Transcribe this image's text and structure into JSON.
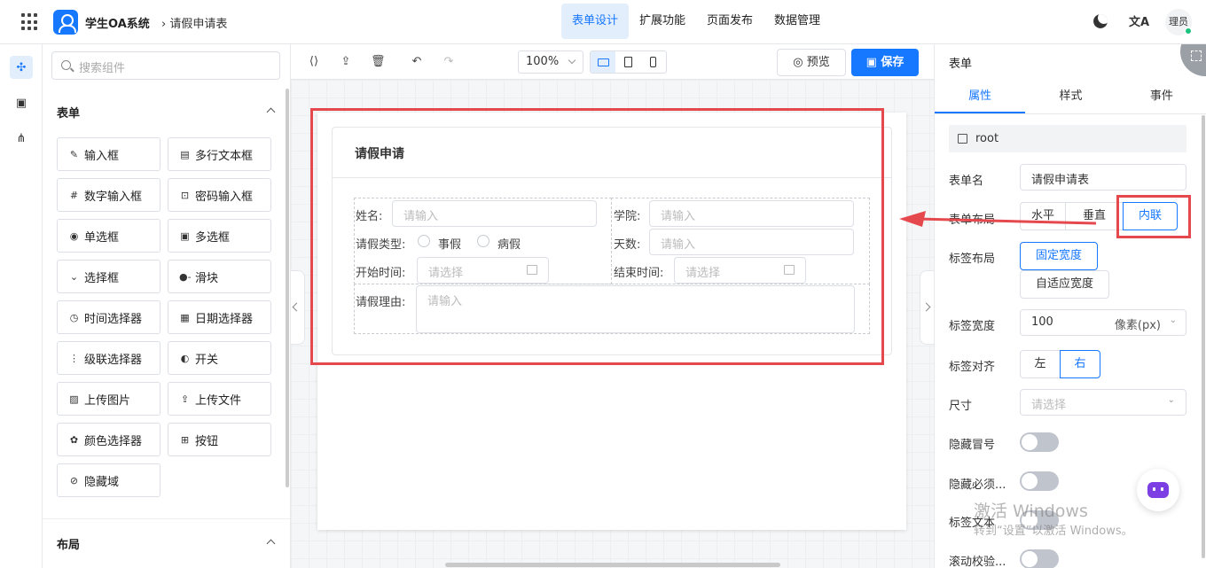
{
  "topbar": {
    "app_name": "学生OA系统",
    "breadcrumb": "请假申请表",
    "nav": [
      "表单设计",
      "扩展功能",
      "页面发布",
      "数据管理"
    ],
    "active_nav": "表单设计",
    "lang_label": "文A",
    "avatar_text": "理员"
  },
  "components": {
    "search_placeholder": "搜索组件",
    "section_form": "表单",
    "section_layout": "布局",
    "items": [
      {
        "label": "输入框",
        "icon": "pencil-icon"
      },
      {
        "label": "多行文本框",
        "icon": "textarea-icon"
      },
      {
        "label": "数字输入框",
        "icon": "number-icon"
      },
      {
        "label": "密码输入框",
        "icon": "lock-icon"
      },
      {
        "label": "单选框",
        "icon": "radio-icon"
      },
      {
        "label": "多选框",
        "icon": "checkbox-icon"
      },
      {
        "label": "选择框",
        "icon": "select-icon"
      },
      {
        "label": "滑块",
        "icon": "slider-icon"
      },
      {
        "label": "时间选择器",
        "icon": "clock-icon"
      },
      {
        "label": "日期选择器",
        "icon": "calendar-icon"
      },
      {
        "label": "级联选择器",
        "icon": "cascader-icon"
      },
      {
        "label": "开关",
        "icon": "switch-icon"
      },
      {
        "label": "上传图片",
        "icon": "image-icon"
      },
      {
        "label": "上传文件",
        "icon": "upload-icon"
      },
      {
        "label": "颜色选择器",
        "icon": "palette-icon"
      },
      {
        "label": "按钮",
        "icon": "button-icon"
      },
      {
        "label": "隐藏域",
        "icon": "eye-off-icon"
      }
    ]
  },
  "toolbar": {
    "zoom": "100%",
    "preview": "预览",
    "save": "保存"
  },
  "form": {
    "title": "请假申请",
    "name_label": "姓名:",
    "name_placeholder": "请输入",
    "college_label": "学院:",
    "college_placeholder": "请输入",
    "type_label": "请假类型:",
    "type_options": [
      "事假",
      "病假"
    ],
    "days_label": "天数:",
    "days_placeholder": "请输入",
    "start_label": "开始时间:",
    "start_placeholder": "请选择",
    "end_label": "结束时间:",
    "end_placeholder": "请选择",
    "reason_label": "请假理由:",
    "reason_placeholder": "请输入"
  },
  "props": {
    "title": "表单",
    "tabs": [
      "属性",
      "样式",
      "事件"
    ],
    "active_tab": "属性",
    "root": "root",
    "form_name_label": "表单名",
    "form_name_value": "请假申请表",
    "layout_label": "表单布局",
    "layout_options": [
      "水平",
      "垂直",
      "内联"
    ],
    "layout_selected": "内联",
    "label_layout_label": "标签布局",
    "label_layout_options": [
      "固定宽度",
      "自适应宽度"
    ],
    "label_layout_selected": "固定宽度",
    "label_width_label": "标签宽度",
    "label_width_value": "100",
    "label_width_unit": "像素(px)",
    "label_align_label": "标签对齐",
    "label_align_options": [
      "左",
      "右"
    ],
    "label_align_selected": "右",
    "size_label": "尺寸",
    "size_placeholder": "请选择",
    "hide_colon_label": "隐藏冒号",
    "hide_required_label": "隐藏必须...",
    "label_text_label": "标签文本",
    "scroll_validate_label": "滚动校验..."
  },
  "watermark": {
    "line1": "激活 Windows",
    "line2": "转到“设置”以激活 Windows。"
  },
  "colors": {
    "accent": "#1677ff",
    "annotation_red": "#e5484d"
  }
}
